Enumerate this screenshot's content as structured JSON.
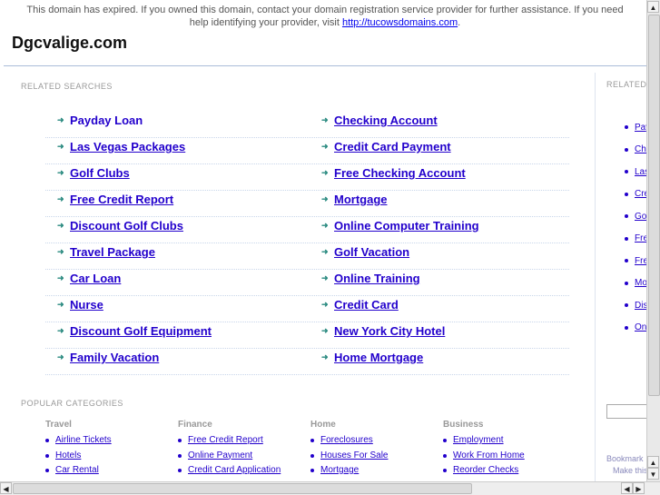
{
  "notice": {
    "text": "This domain has expired. If you owned this domain, contact your domain registration service provider for further assistance. If you need help identifying your provider, visit ",
    "link": "http://tucowsdomains.com",
    "end": "."
  },
  "site_title": "Dgcvalige.com",
  "related_label": "RELATED SEARCHES",
  "related_left": [
    "Payday Loan",
    "Las Vegas Packages",
    "Golf Clubs",
    "Free Credit Report",
    "Discount Golf Clubs",
    "Travel Package",
    "Car Loan",
    "Nurse",
    "Discount Golf Equipment",
    "Family Vacation"
  ],
  "related_right": [
    "Checking Account",
    "Credit Card Payment",
    "Free Checking Account",
    "Mortgage",
    "Online Computer Training",
    "Golf Vacation",
    "Online Training",
    "Credit Card",
    "New York City Hotel",
    "Home Mortgage"
  ],
  "popular_label": "POPULAR CATEGORIES",
  "categories": [
    {
      "title": "Travel",
      "items": [
        "Airline Tickets",
        "Hotels",
        "Car Rental"
      ]
    },
    {
      "title": "Finance",
      "items": [
        "Free Credit Report",
        "Online Payment",
        "Credit Card Application"
      ]
    },
    {
      "title": "Home",
      "items": [
        "Foreclosures",
        "Houses For Sale",
        "Mortgage"
      ]
    },
    {
      "title": "Business",
      "items": [
        "Employment",
        "Work From Home",
        "Reorder Checks"
      ]
    }
  ],
  "sidebar": {
    "label": "RELATED",
    "items": [
      "Payday Loan",
      "Checking Account",
      "Las Vegas Packages",
      "Credit Card Payment",
      "Golf Clubs",
      "Free Credit Report",
      "Free Checking Account",
      "Mortgage",
      "Discount Golf Clubs",
      "Online Computer Training"
    ],
    "bookmark": "Bookmark",
    "make": "Make this"
  },
  "colors": {
    "link": "#2200cc",
    "arrow": "#2a8a80",
    "rule": "#a9bcd8"
  }
}
